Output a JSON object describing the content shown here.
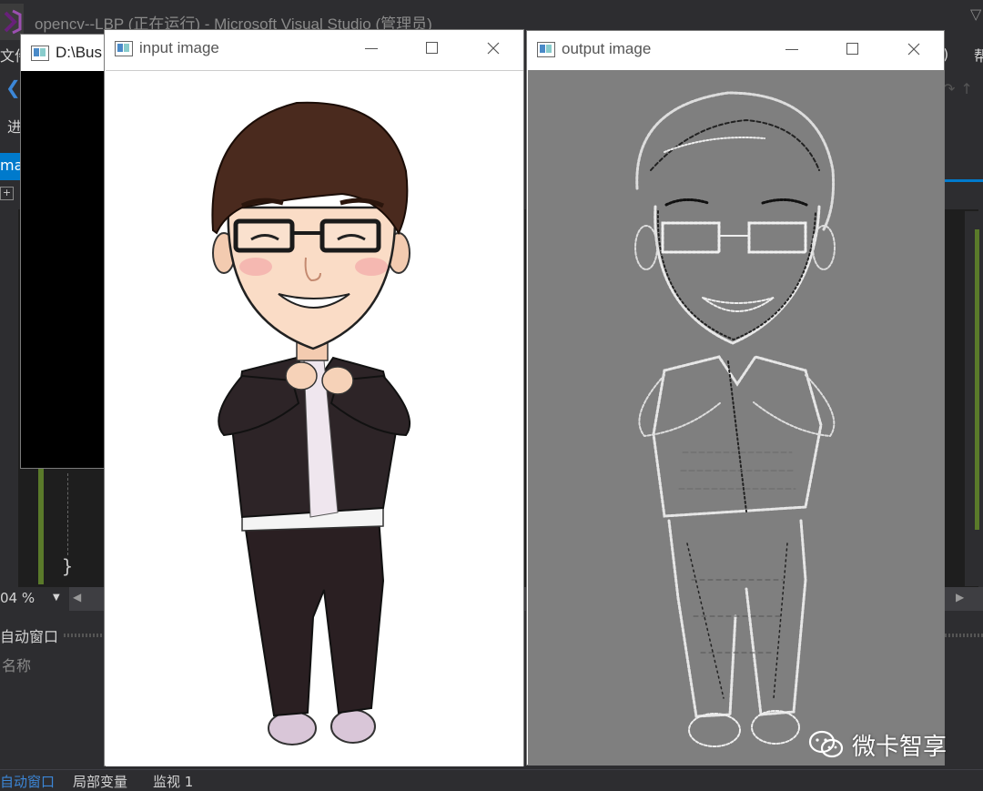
{
  "vs": {
    "title": "opencv--LBP (正在运行) - Microsoft Visual Studio (管理员)",
    "menu_file": "文件",
    "menu_right_paren": ")",
    "menu_right_char": "帮",
    "proc_label": "进",
    "tab_label": "mai",
    "gutter_label": "+",
    "zoom": "04 %",
    "autos_header": "自动窗口",
    "col_name": "名称",
    "bottom_tabs": [
      "自动窗口",
      "局部变量",
      "监视 1"
    ],
    "closing_brace": "}"
  },
  "console": {
    "title": "D:\\Bus"
  },
  "input_window": {
    "title": "input image"
  },
  "output_window": {
    "title": "output image"
  },
  "watermark": {
    "text": "微卡智享",
    "icon": "wechat-icon"
  },
  "colors": {
    "vs_background": "#2d2d30",
    "vs_accent": "#007acc",
    "output_canvas_gray": "#7f7f7f"
  }
}
